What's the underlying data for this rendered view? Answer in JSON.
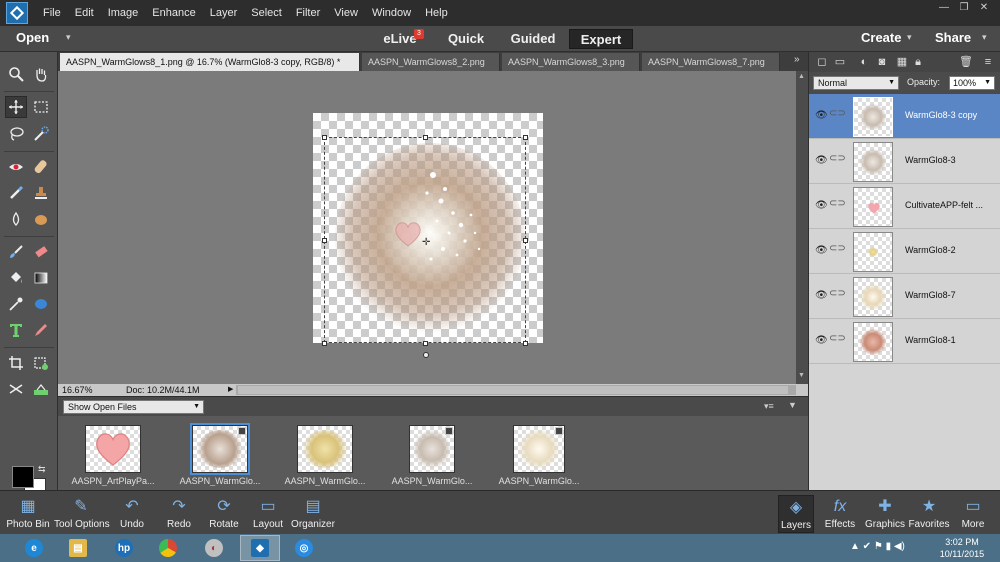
{
  "menu": [
    "File",
    "Edit",
    "Image",
    "Enhance",
    "Layer",
    "Select",
    "Filter",
    "View",
    "Window",
    "Help"
  ],
  "window_controls": {
    "minimize": "—",
    "restore": "❐",
    "close": "✕"
  },
  "modebar": {
    "open": "Open",
    "elive": "eLive",
    "elive_badge": "3",
    "quick": "Quick",
    "guided": "Guided",
    "expert": "Expert",
    "create": "Create",
    "share": "Share"
  },
  "tabs": [
    "AASPN_WarmGlows8_1.png @ 16.7% (WarmGlo8-3 copy, RGB/8) *",
    "AASPN_WarmGlows8_2.png",
    "AASPN_WarmGlows8_3.png",
    "AASPN_WarmGlows8_7.png"
  ],
  "tab_overflow": "»",
  "status": {
    "zoom": "16.67%",
    "doc": "Doc: 10.2M/44.1M"
  },
  "bin": {
    "source": "Show Open Files",
    "thumbs": [
      {
        "label": "AASPN_ArtPlayPa...",
        "color": "#f29a9a"
      },
      {
        "label": "AASPN_WarmGlo...",
        "color": "#b9a08e"
      },
      {
        "label": "AASPN_WarmGlo...",
        "color": "#d9c27a"
      },
      {
        "label": "AASPN_WarmGlo...",
        "color": "#c8bcb0"
      },
      {
        "label": "AASPN_WarmGlo...",
        "color": "#e8dcc0"
      }
    ]
  },
  "layers_panel": {
    "blend_mode": "Normal",
    "opacity_label": "Opacity:",
    "opacity": "100%",
    "layers": [
      {
        "name": "WarmGlo8-3 copy",
        "selected": true,
        "color": "#c8bcb0"
      },
      {
        "name": "WarmGlo8-3",
        "selected": false,
        "color": "#c8bcb0"
      },
      {
        "name": "CultivateAPP-felt ...",
        "selected": false,
        "color": "#f4a6ae"
      },
      {
        "name": "WarmGlo8-2",
        "selected": false,
        "color": "#e6d08a"
      },
      {
        "name": "WarmGlo8-7",
        "selected": false,
        "color": "#e8d8b8"
      },
      {
        "name": "WarmGlo8-1",
        "selected": false,
        "color": "#c98b76"
      }
    ]
  },
  "actions_left": [
    {
      "label": "Photo Bin",
      "icon": "▦"
    },
    {
      "label": "Tool Options",
      "icon": "✎"
    },
    {
      "label": "Undo",
      "icon": "↶"
    },
    {
      "label": "Redo",
      "icon": "↷"
    },
    {
      "label": "Rotate",
      "icon": "⟳"
    },
    {
      "label": "Layout",
      "icon": "▭"
    },
    {
      "label": "Organizer",
      "icon": "▤"
    }
  ],
  "actions_right": [
    {
      "label": "Layers",
      "icon": "◈"
    },
    {
      "label": "Effects",
      "icon": "fx"
    },
    {
      "label": "Graphics",
      "icon": "✚"
    },
    {
      "label": "Favorites",
      "icon": "★"
    },
    {
      "label": "More",
      "icon": "▭"
    }
  ],
  "taskbar": {
    "apps": [
      {
        "name": "ie",
        "glyph": "e",
        "color": "#1e88d6"
      },
      {
        "name": "explorer",
        "glyph": "▤",
        "color": "#e2b84a"
      },
      {
        "name": "hp",
        "glyph": "hp",
        "color": "#1d6fb8"
      },
      {
        "name": "chrome",
        "glyph": "●",
        "color": "#d94836"
      },
      {
        "name": "paint",
        "glyph": "◐",
        "color": "#c0c0c0"
      },
      {
        "name": "photoshop-elements",
        "glyph": "◆",
        "color": "#1f6fb0"
      },
      {
        "name": "sync",
        "glyph": "◎",
        "color": "#2a8be0"
      }
    ],
    "tray": "▲ ✔ ⚑ ▮ ◀)",
    "time": "3:02 PM",
    "date": "10/11/2015"
  }
}
